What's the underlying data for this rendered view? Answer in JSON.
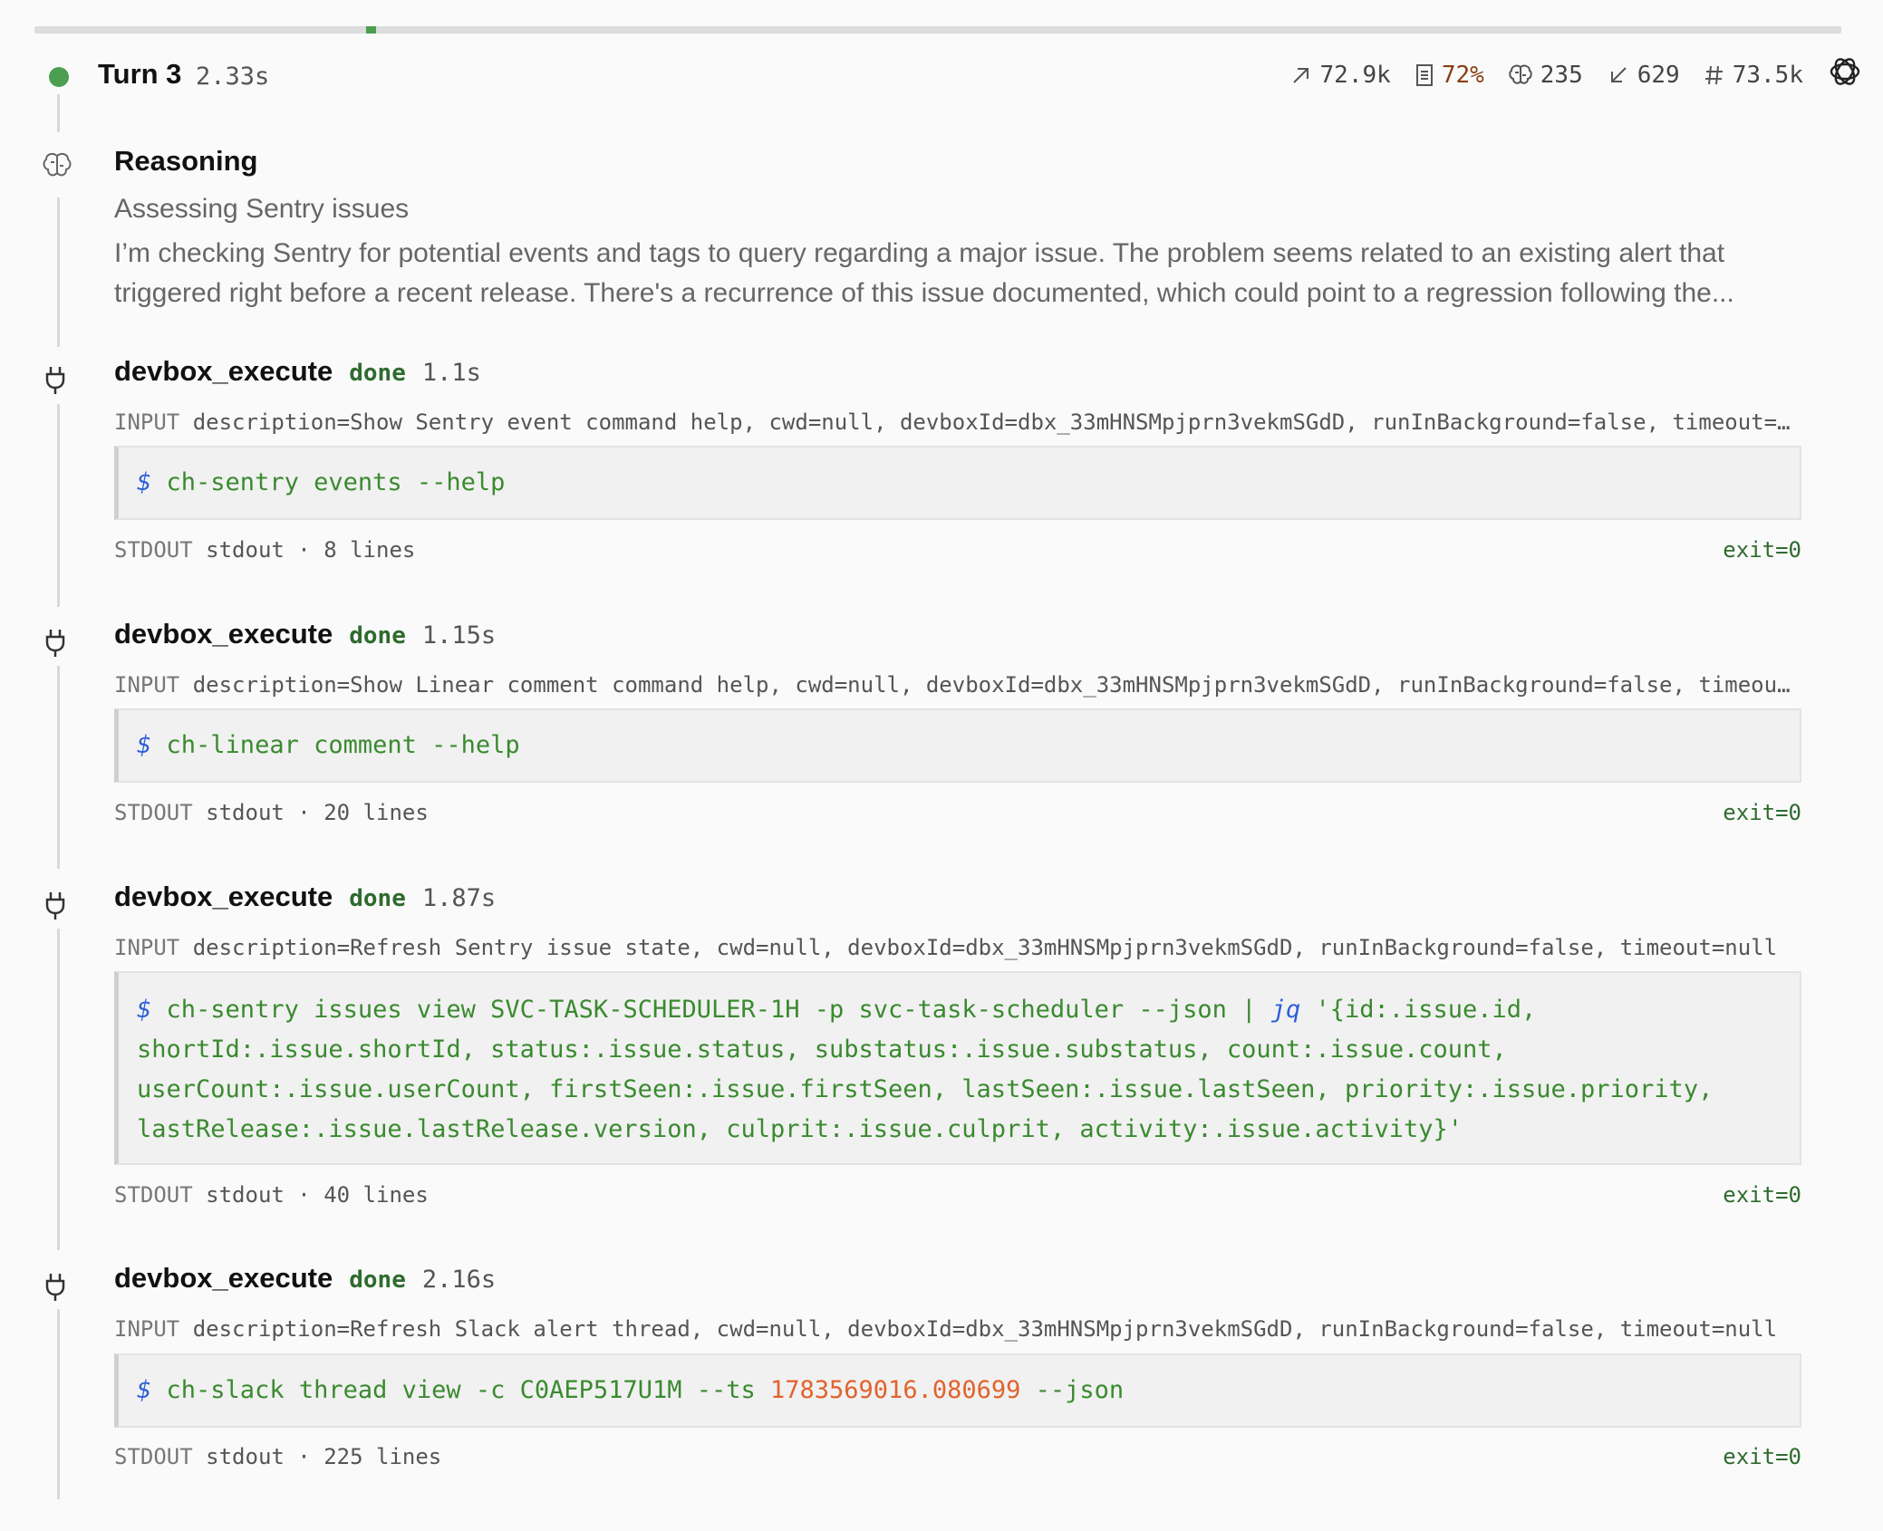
{
  "turn": {
    "title": "Turn 3",
    "duration": "2.33s",
    "status_color": "#4c9e50",
    "stats": {
      "tokens_in": "72.9k",
      "context_pct": "72%",
      "reasoning_tokens": "235",
      "tokens_out": "629",
      "total_tokens": "73.5k"
    }
  },
  "reasoning": {
    "title": "Reasoning",
    "subtitle": "Assessing Sentry issues",
    "body": "I’m checking Sentry for potential events and tags to query regarding a major issue. The problem seems related to an existing alert that triggered right before a recent release. There's a recurrence of this issue documented, which could point to a regression following the..."
  },
  "labels": {
    "input_tag": "INPUT",
    "stdout_tag": "STDOUT",
    "prompt": "$"
  },
  "tools": [
    {
      "name": "devbox_execute",
      "status": "done",
      "duration": "1.1s",
      "input": "description=Show Sentry event command help, cwd=null, devboxId=dbx_33mHNSMpjprn3vekmSGdD, runInBackground=false, timeout=null",
      "command": "ch-sentry events --help",
      "stdout": "stdout · 8 lines",
      "exit": "exit=0"
    },
    {
      "name": "devbox_execute",
      "status": "done",
      "duration": "1.15s",
      "input": "description=Show Linear comment command help, cwd=null, devboxId=dbx_33mHNSMpjprn3vekmSGdD, runInBackground=false, timeout=null",
      "command": "ch-linear comment --help",
      "stdout": "stdout · 20 lines",
      "exit": "exit=0"
    },
    {
      "name": "devbox_execute",
      "status": "done",
      "duration": "1.87s",
      "input": "description=Refresh Sentry issue state, cwd=null, devboxId=dbx_33mHNSMpjprn3vekmSGdD, runInBackground=false, timeout=null",
      "command_pre": "ch-sentry issues view SVC-TASK-SCHEDULER-1H -p svc-task-scheduler --json | ",
      "command_jq": "jq",
      "command_line1_rest": " '{id:.issue.id,",
      "command_line2": "shortId:.issue.shortId, status:.issue.status, substatus:.issue.substatus, count:.issue.count,",
      "command_line3": "userCount:.issue.userCount, firstSeen:.issue.firstSeen, lastSeen:.issue.lastSeen, priority:.issue.priority,",
      "command_line4": "lastRelease:.issue.lastRelease.version, culprit:.issue.culprit, activity:.issue.activity}'",
      "stdout": "stdout · 40 lines",
      "exit": "exit=0"
    },
    {
      "name": "devbox_execute",
      "status": "done",
      "duration": "2.16s",
      "input": "description=Refresh Slack alert thread, cwd=null, devboxId=dbx_33mHNSMpjprn3vekmSGdD, runInBackground=false, timeout=null",
      "command_pre": "ch-slack thread view -c C0AEP517U1M --ts ",
      "command_num": "1783569016.080699",
      "command_post": " --json",
      "stdout": "stdout · 225 lines",
      "exit": "exit=0"
    }
  ]
}
